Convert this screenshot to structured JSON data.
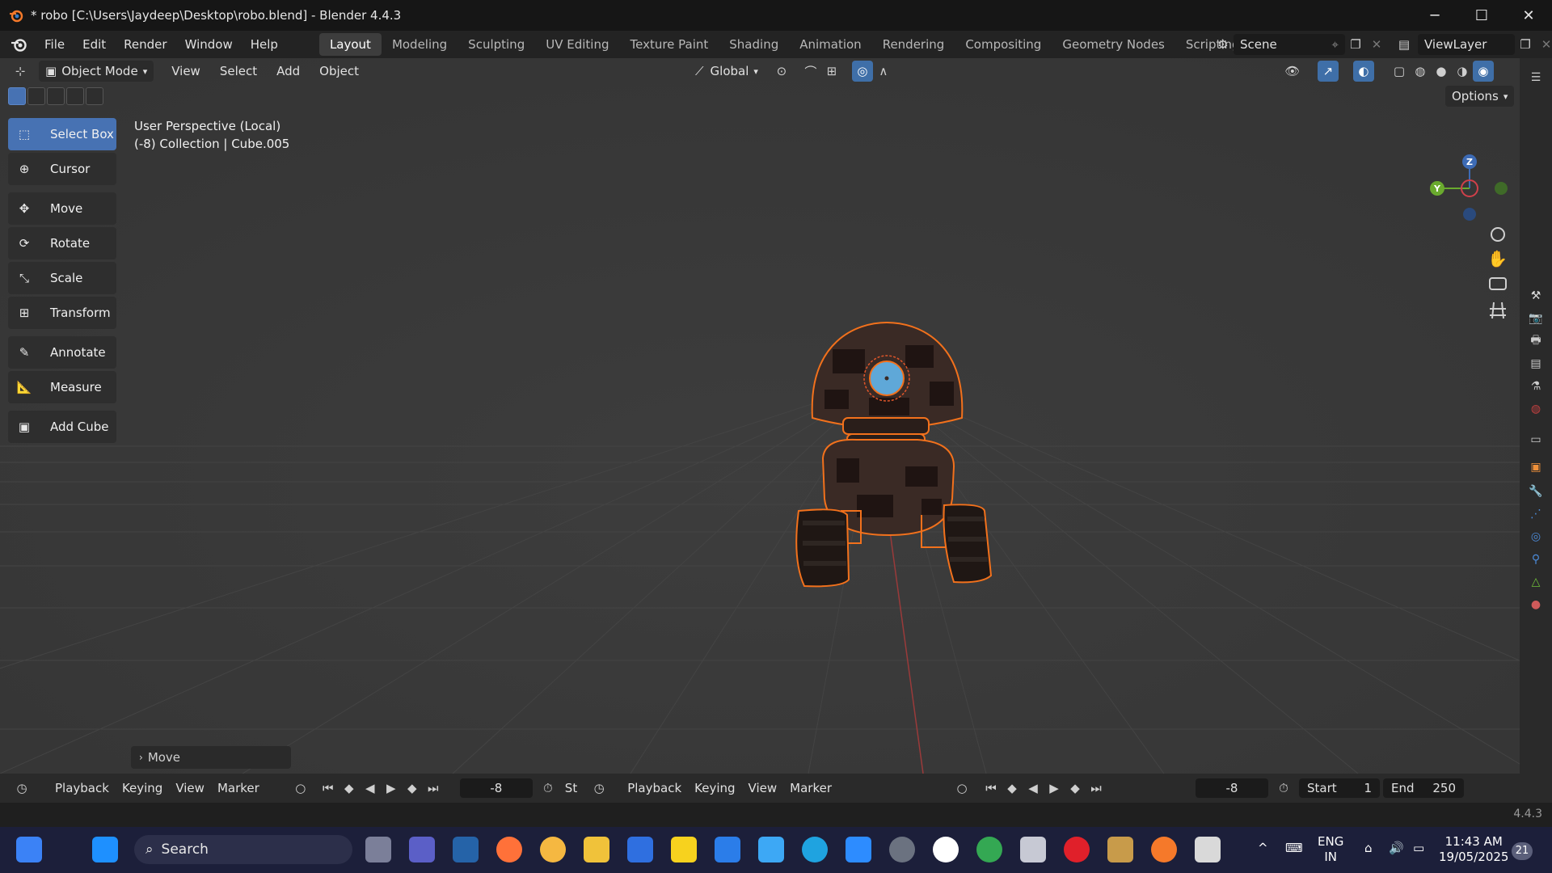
{
  "window": {
    "title": "* robo [C:\\Users\\Jaydeep\\Desktop\\robo.blend] - Blender 4.4.3",
    "minimize": "─",
    "maximize": "☐",
    "close": "✕"
  },
  "menu": [
    "File",
    "Edit",
    "Render",
    "Window",
    "Help"
  ],
  "workspaces": [
    "Layout",
    "Modeling",
    "Sculpting",
    "UV Editing",
    "Texture Paint",
    "Shading",
    "Animation",
    "Rendering",
    "Compositing",
    "Geometry Nodes",
    "Scripting"
  ],
  "active_workspace": "Layout",
  "scene": {
    "name": "Scene",
    "view_layer": "ViewLayer"
  },
  "viewport_header": {
    "mode": "Object Mode",
    "menus": [
      "View",
      "Select",
      "Add",
      "Object"
    ],
    "transform_orientation": "Global"
  },
  "viewport": {
    "perspective": "User Perspective (Local)",
    "collection_info": "(-8) Collection | Cube.005",
    "options_label": "Options",
    "last_operator": "Move"
  },
  "tools": [
    {
      "label": "Select Box",
      "icon": "select-box-icon",
      "active": true
    },
    {
      "label": "Cursor",
      "icon": "cursor-icon"
    },
    {
      "label": "Move",
      "icon": "move-icon"
    },
    {
      "label": "Rotate",
      "icon": "rotate-icon"
    },
    {
      "label": "Scale",
      "icon": "scale-icon"
    },
    {
      "label": "Transform",
      "icon": "transform-icon"
    },
    {
      "label": "Annotate",
      "icon": "annotate-icon"
    },
    {
      "label": "Measure",
      "icon": "measure-icon"
    },
    {
      "label": "Add Cube",
      "icon": "add-cube-icon"
    }
  ],
  "gizmo": {
    "z": "Z",
    "y": "Y"
  },
  "timeline": {
    "left": {
      "menus": [
        "Playback",
        "Keying",
        "View",
        "Marker"
      ],
      "frame": "-8",
      "truncated": "St"
    },
    "right": {
      "menus": [
        "Playback",
        "Keying",
        "View",
        "Marker"
      ],
      "frame": "-8",
      "start_label": "Start",
      "start": "1",
      "end_label": "End",
      "end": "250"
    }
  },
  "status": {
    "version": "4.4.3"
  },
  "taskbar": {
    "search_placeholder": "Search",
    "lang": "ENG",
    "region": "IN",
    "time": "11:43 AM",
    "date": "19/05/2025",
    "notifications": "21"
  },
  "colors": {
    "accent": "#4772b3",
    "selection_outline": "#f2711c",
    "viewport_bg": "#393939"
  }
}
